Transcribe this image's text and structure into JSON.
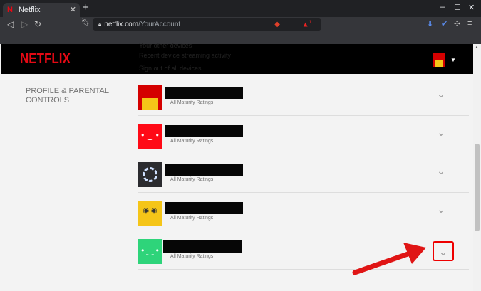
{
  "browser": {
    "tab_title": "Netflix",
    "url_domain": "netflix.com",
    "url_path": "/YourAccount",
    "notif_count": "1"
  },
  "header": {
    "logo": "NETFLIX",
    "ghost_items": [
      "Your other devices",
      "Recent device streaming activity",
      "Sign out of all devices"
    ]
  },
  "section": {
    "title": "PROFILE & PARENTAL CONTROLS"
  },
  "profiles": [
    {
      "rating": "All Maturity Ratings",
      "color": "#d40000"
    },
    {
      "rating": "All Maturity Ratings",
      "color": "#ff0a16"
    },
    {
      "rating": "All Maturity Ratings",
      "color": "#2b2b2f"
    },
    {
      "rating": "All Maturity Ratings",
      "color": "#f5c518"
    },
    {
      "rating": "All Maturity Ratings",
      "color": "#2ed47a"
    }
  ]
}
